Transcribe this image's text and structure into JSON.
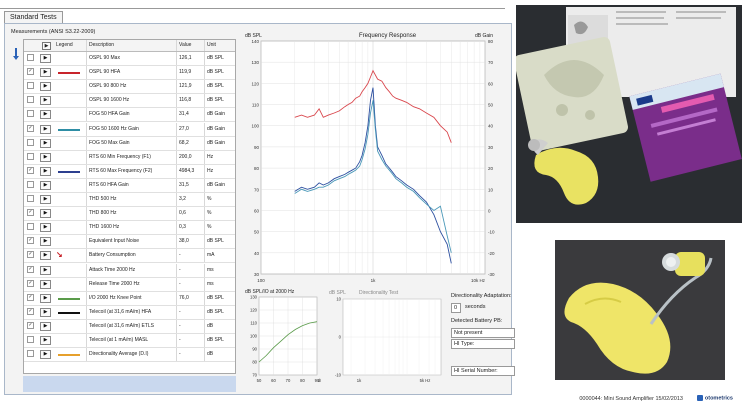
{
  "tab": {
    "label": "Standard Tests"
  },
  "measurements": {
    "label": "Measurements (ANSI S3.22-2009)",
    "columns": {
      "legend": "Legend",
      "description": "Description",
      "value": "Value",
      "unit": "Unit"
    },
    "rows": [
      {
        "desc": "OSPL 90 Max",
        "val": "126,1",
        "unit": "dB SPL",
        "check": "",
        "legend_color": "",
        "marker": ""
      },
      {
        "desc": "OSPL 90 HFA",
        "val": "119,9",
        "unit": "dB SPL",
        "check": "✓",
        "legend_color": "#c8242b",
        "marker": ""
      },
      {
        "desc": "OSPL 90 800 Hz",
        "val": "121,9",
        "unit": "dB SPL",
        "check": "",
        "legend_color": "",
        "marker": ""
      },
      {
        "desc": "OSPL 90 1600 Hz",
        "val": "116,8",
        "unit": "dB SPL",
        "check": "",
        "legend_color": "",
        "marker": ""
      },
      {
        "desc": "FOG 50 HFA Gain",
        "val": "31,4",
        "unit": "dB Gain",
        "check": "",
        "legend_color": "",
        "marker": ""
      },
      {
        "desc": "FOG 50 1600 Hz Gain",
        "val": "27,0",
        "unit": "dB Gain",
        "check": "✓",
        "legend_color": "#2e8ea5",
        "marker": ""
      },
      {
        "desc": "FOG 50 Max Gain",
        "val": "68,2",
        "unit": "dB Gain",
        "check": "",
        "legend_color": "",
        "marker": ""
      },
      {
        "desc": "RTS 60 Min Frequency (F1)",
        "val": "200,0",
        "unit": "Hz",
        "check": "",
        "legend_color": "",
        "marker": ""
      },
      {
        "desc": "RTS 60 Max Frequency (F2)",
        "val": "4984,3",
        "unit": "Hz",
        "check": "✓",
        "legend_color": "#2c3f8f",
        "marker": ""
      },
      {
        "desc": "RTS 60 HFA Gain",
        "val": "31,5",
        "unit": "dB Gain",
        "check": "",
        "legend_color": "",
        "marker": ""
      },
      {
        "desc": "THD 500 Hz",
        "val": "3,2",
        "unit": "%",
        "check": "",
        "legend_color": "",
        "marker": ""
      },
      {
        "desc": "THD 800 Hz",
        "val": "0,6",
        "unit": "%",
        "check": "✓",
        "legend_color": "",
        "marker": ""
      },
      {
        "desc": "THD 1600 Hz",
        "val": "0,3",
        "unit": "%",
        "check": "",
        "legend_color": "",
        "marker": ""
      },
      {
        "desc": "Equivalent Input Noise",
        "val": "38,0",
        "unit": "dB SPL",
        "check": "✓",
        "legend_color": "",
        "marker": ""
      },
      {
        "desc": "Battery Consumption",
        "val": "-",
        "unit": "mA",
        "check": "✓",
        "legend_color": "",
        "marker": "x"
      },
      {
        "desc": "Attack Time 2000 Hz",
        "val": "-",
        "unit": "ms",
        "check": "✓",
        "legend_color": "",
        "marker": ""
      },
      {
        "desc": "Release Time 2000 Hz",
        "val": "-",
        "unit": "ms",
        "check": "✓",
        "legend_color": "",
        "marker": ""
      },
      {
        "desc": "I/O 2000 Hz Knee Point",
        "val": "76,0",
        "unit": "dB SPL",
        "check": "✓",
        "legend_color": "#5a9b4a",
        "marker": ""
      },
      {
        "desc": "Telecoil (at 31,6 mA/m) HFA",
        "val": "-",
        "unit": "dB SPL",
        "check": "✓",
        "legend_color": "#111111",
        "marker": ""
      },
      {
        "desc": "Telecoil (at 31,6 mA/m) ETLS",
        "val": "-",
        "unit": "dB",
        "check": "✓",
        "legend_color": "",
        "marker": ""
      },
      {
        "desc": "Telecoil (at 1 mA/m) MASL",
        "val": "-",
        "unit": "dB SPL",
        "check": "",
        "legend_color": "",
        "marker": ""
      },
      {
        "desc": "Directionality Average (D.I)",
        "val": "-",
        "unit": "dB",
        "check": "",
        "legend_color": "#e6a02c",
        "marker": ""
      }
    ]
  },
  "chart_data": [
    {
      "type": "line",
      "title": "Frequency Response",
      "ylabel_left": "dB SPL",
      "ylabel_right": "dB Gain",
      "xscale": "log",
      "xlim": [
        100,
        10000
      ],
      "x_ticks": [
        "100",
        "1k",
        "10k Hz"
      ],
      "ylim_left": [
        30,
        140
      ],
      "y_ticks_left": [
        30,
        40,
        50,
        60,
        70,
        80,
        90,
        100,
        110,
        120,
        130,
        140
      ],
      "ylim_right": [
        -30,
        80
      ],
      "y_ticks_right": [
        -30,
        -20,
        -10,
        0,
        10,
        20,
        30,
        40,
        50,
        60,
        70,
        80
      ],
      "grid": true,
      "series": [
        {
          "color": "#d9474d",
          "x": [
            200,
            230,
            260,
            300,
            330,
            360,
            400,
            450,
            500,
            560,
            600,
            650,
            700,
            760,
            800,
            850,
            900,
            950,
            1000,
            1100,
            1200,
            1300,
            1400,
            1500,
            1600,
            1800,
            2000,
            2300,
            2600,
            3000,
            3500,
            4000,
            4600,
            5000
          ],
          "y": [
            104,
            105,
            104,
            105,
            108,
            104,
            105,
            106,
            107,
            109,
            110,
            111,
            113,
            114,
            116,
            118,
            120,
            123,
            126,
            122,
            121,
            118,
            116,
            114,
            113,
            112,
            111,
            109,
            108,
            106,
            104,
            100,
            97,
            92
          ]
        },
        {
          "color": "#2c4fa0",
          "x": [
            200,
            230,
            260,
            300,
            330,
            360,
            400,
            450,
            500,
            560,
            600,
            650,
            700,
            760,
            800,
            850,
            900,
            950,
            1000,
            1050,
            1100,
            1200,
            1300,
            1400,
            1500,
            1600,
            1800,
            2000,
            2300,
            2600,
            3000,
            3500,
            4000,
            4600,
            5000
          ],
          "y": [
            69,
            71,
            70,
            71,
            73,
            72,
            73,
            75,
            76,
            77,
            78,
            79,
            80,
            83,
            86,
            92,
            100,
            112,
            118,
            100,
            90,
            86,
            82,
            80,
            78,
            76,
            74,
            72,
            70,
            67,
            64,
            58,
            50,
            44,
            35
          ]
        },
        {
          "color": "#4a98b8",
          "x": [
            200,
            230,
            260,
            300,
            330,
            360,
            400,
            450,
            500,
            560,
            600,
            650,
            700,
            760,
            800,
            850,
            900,
            950,
            1000,
            1050,
            1100,
            1200,
            1300,
            1400,
            1500,
            1600,
            1800,
            2000,
            2300,
            2600,
            3000,
            3500,
            4000,
            4600,
            5000
          ],
          "y": [
            68,
            70,
            69,
            70,
            71,
            71,
            72,
            74,
            75,
            76,
            77,
            78,
            79,
            81,
            84,
            89,
            96,
            106,
            112,
            98,
            88,
            84,
            81,
            79,
            77,
            75,
            73,
            71,
            69,
            66,
            63,
            60,
            62,
            48,
            40
          ]
        }
      ]
    },
    {
      "type": "line",
      "title": "dB SPL/IO at 2000 Hz",
      "xlim": [
        50,
        90
      ],
      "x_ticks": [
        50,
        60,
        70,
        80,
        90
      ],
      "x_unit": "dB",
      "ylim": [
        70,
        130
      ],
      "y_ticks": [
        70,
        80,
        90,
        100,
        110,
        120,
        130
      ],
      "grid": true,
      "series": [
        {
          "color": "#5a9b4a",
          "x": [
            50,
            55,
            60,
            65,
            70,
            75,
            80,
            85,
            90
          ],
          "y": [
            80,
            85,
            91,
            96,
            101,
            105,
            108,
            110,
            111
          ]
        }
      ]
    },
    {
      "type": "line",
      "title": "Directionality Test",
      "xscale": "log",
      "x_ticks": [
        "1k",
        "5k Hz"
      ],
      "ylim": [
        -10,
        10
      ],
      "y_ticks": [
        10,
        0,
        -10
      ],
      "y_unit": "dB SPL",
      "grid": true,
      "series": []
    }
  ],
  "directionality": {
    "adaptation_label": "Directionality Adaptation:",
    "adaptation_value": "0",
    "adaptation_unit": "seconds",
    "battery_label": "Detected Battery PB:",
    "battery_value": "Not present",
    "type_label": "HI Type:",
    "serial_label": "HI Serial Number:"
  },
  "status": {
    "text": "0000044: Mini Sound Amplifier 15/02/2013",
    "brand": "otometrics"
  },
  "colors": {
    "red": "#d9474d",
    "blue": "#2c4fa0",
    "teal": "#4a98b8",
    "green": "#5a9b4a",
    "band": "#c9d8ee"
  }
}
